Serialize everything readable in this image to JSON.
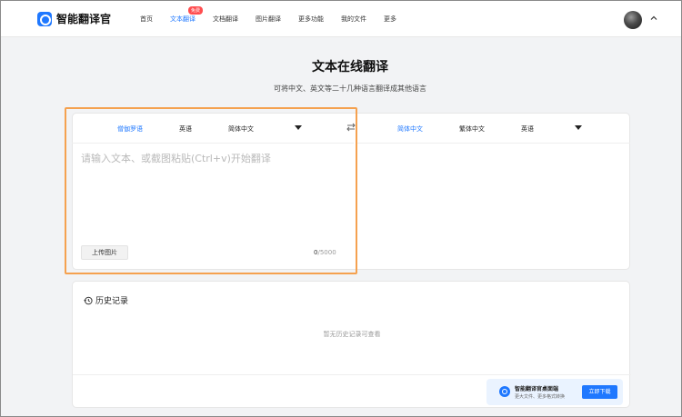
{
  "app": {
    "logo_text": "智能翻译官",
    "brand_color": "#1f78ff"
  },
  "nav": {
    "items": [
      {
        "label": "首页"
      },
      {
        "label": "文本翻译",
        "active": true,
        "badge": "免费"
      },
      {
        "label": "文档翻译"
      },
      {
        "label": "图片翻译"
      },
      {
        "label": "更多功能"
      },
      {
        "label": "我的文件"
      },
      {
        "label": "更多"
      }
    ],
    "collapse_icon": "chevron-up-icon"
  },
  "page": {
    "title": "文本在线翻译",
    "subtitle": "可将中文、英文等二十几种语言翻译成其他语言"
  },
  "translator": {
    "source_langs": [
      "僧伽罗语",
      "英语",
      "简体中文"
    ],
    "source_selected": "僧伽罗语",
    "target_langs": [
      "简体中文",
      "繁体中文",
      "英语"
    ],
    "target_selected": "简体中文",
    "input_value": "",
    "input_placeholder": "请输入文本、或截图粘贴(Ctrl+v)开始翻译",
    "upload_label": "上传图片",
    "counter_current": "0",
    "counter_max": "/5000",
    "highlight_color": "#f5a14f"
  },
  "history": {
    "title": "历史记录",
    "empty_text": "暂无历史记录可查看"
  },
  "promo": {
    "title": "智能翻译官桌面端",
    "subtitle": "更大文件、更多格式转换",
    "button_label": "立即下载"
  }
}
